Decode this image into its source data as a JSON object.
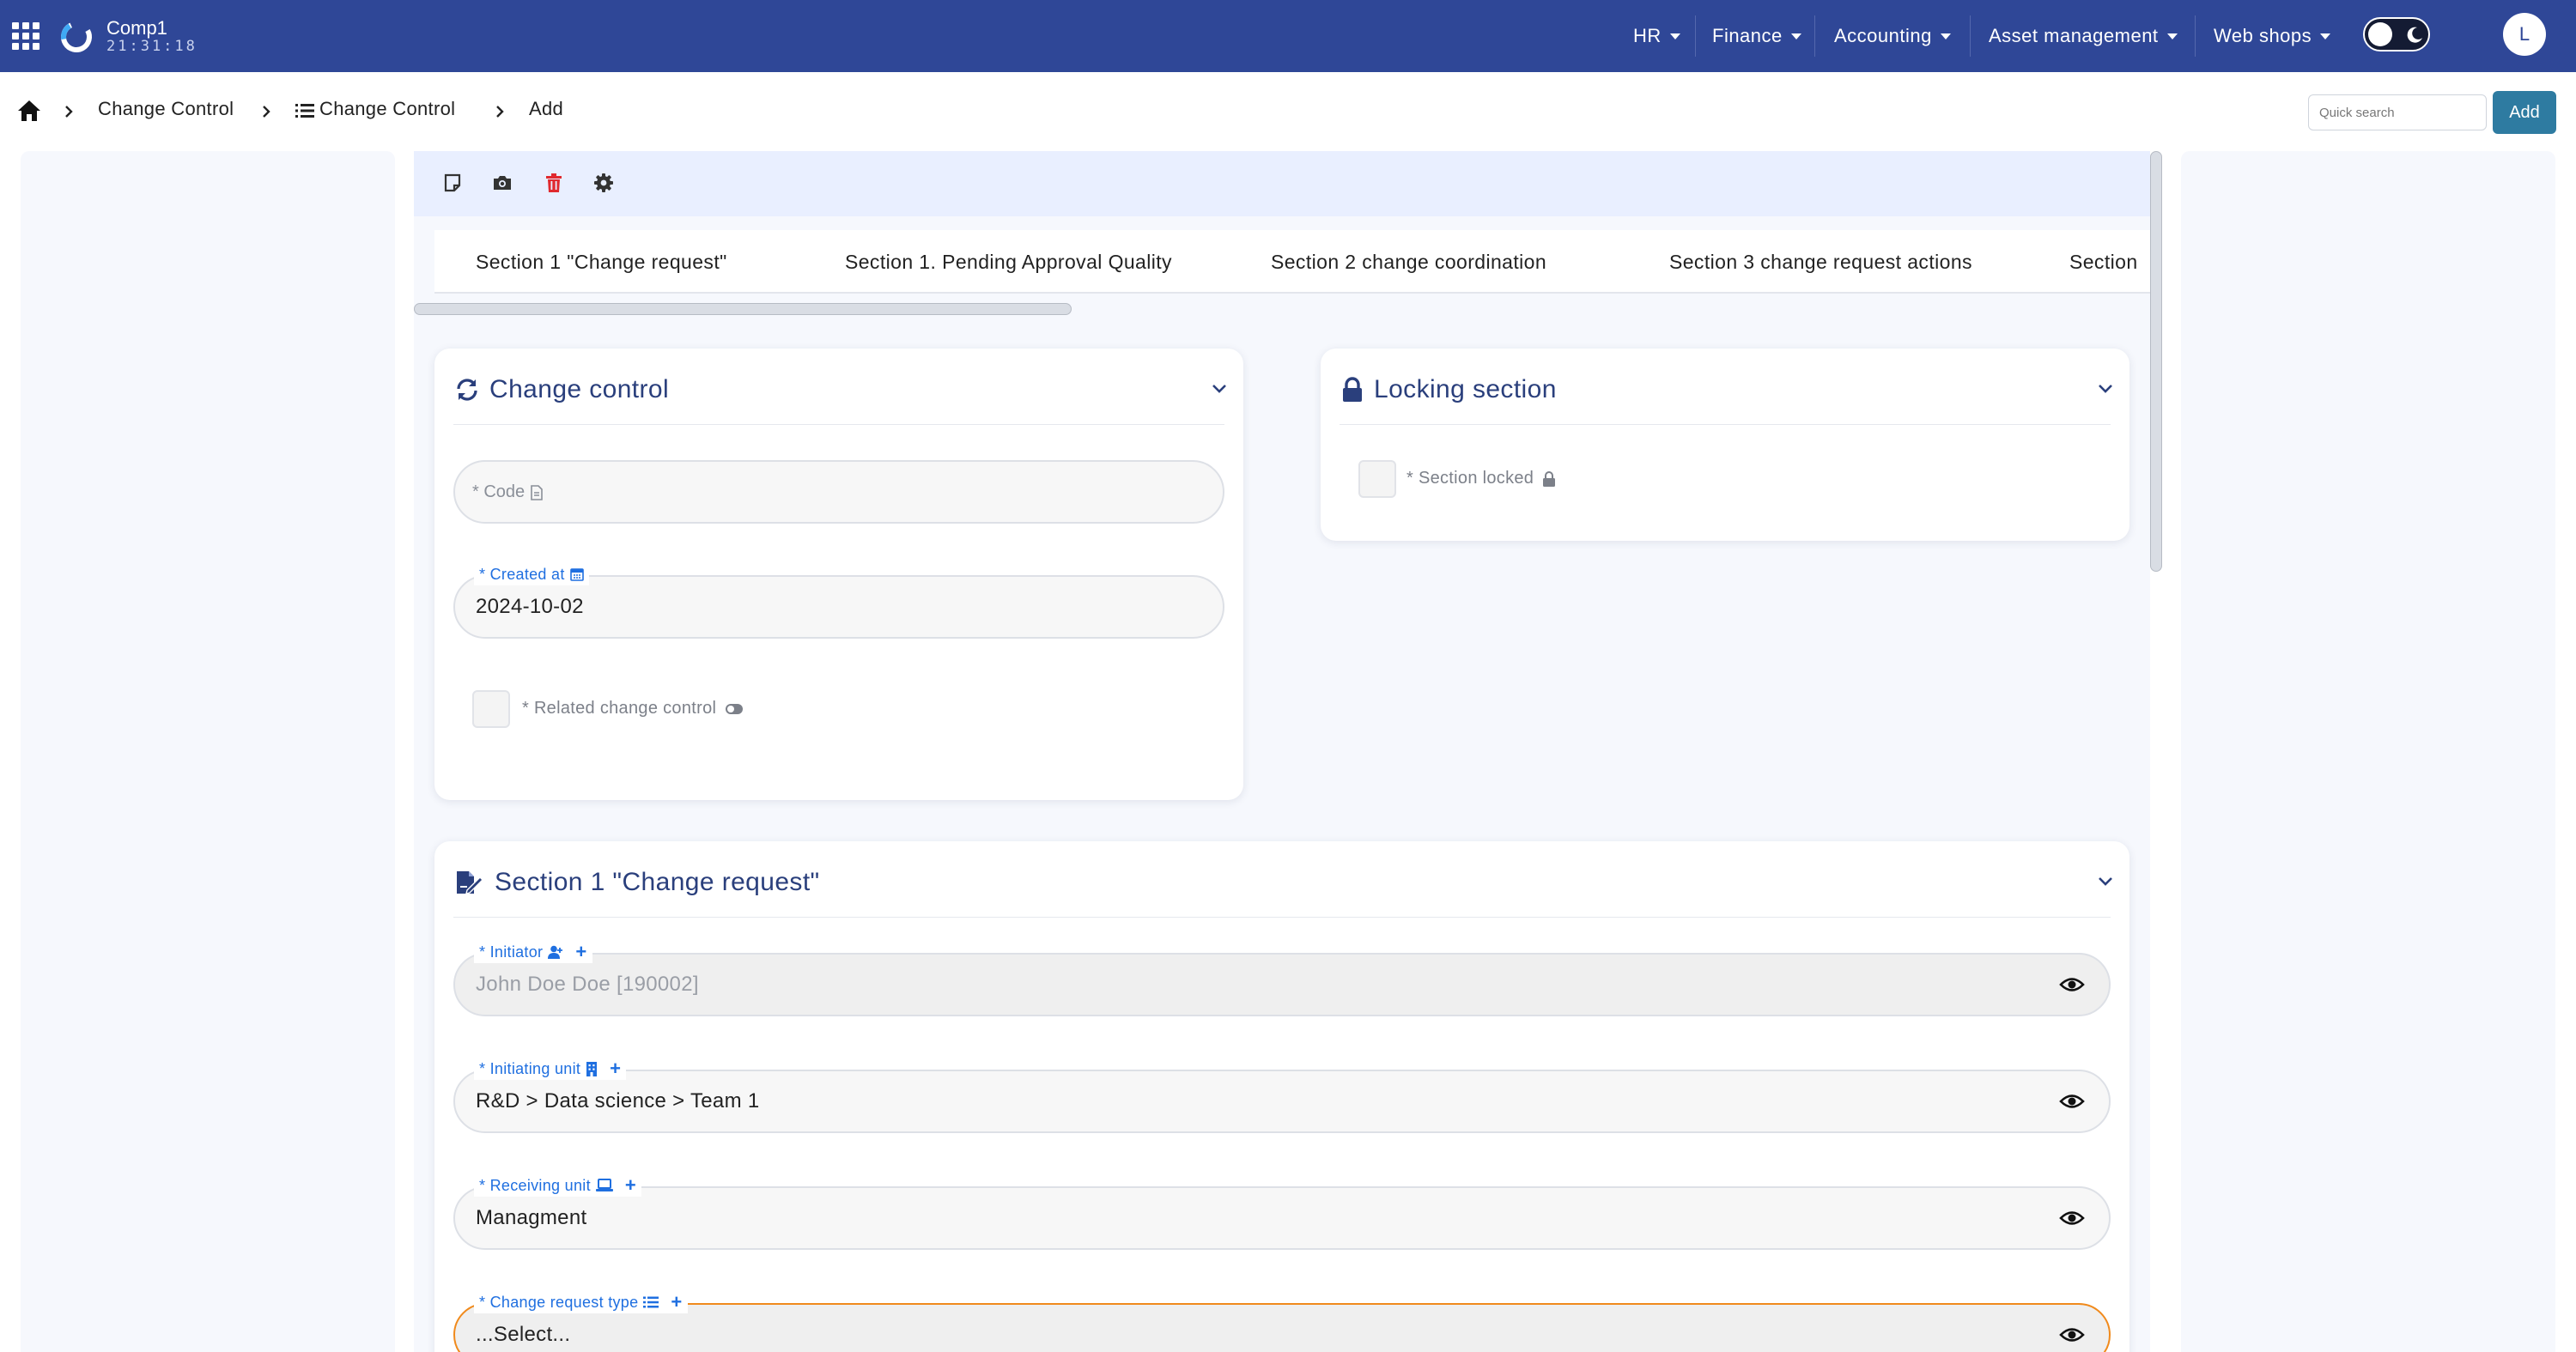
{
  "header": {
    "company": "Comp1",
    "clock": "21:31:18",
    "menus": [
      "HR",
      "Finance",
      "Accounting",
      "Asset management",
      "Web shops"
    ],
    "avatar_initial": "L"
  },
  "breadcrumb": {
    "items": [
      "Change Control",
      "Change Control",
      "Add"
    ]
  },
  "search": {
    "placeholder": "Quick search"
  },
  "actions": {
    "add_label": "Add"
  },
  "tabs": [
    "Section 1 \"Change request\"",
    "Section 1. Pending Approval Quality",
    "Section 2 change coordination",
    "Section 3 change request actions",
    "Section"
  ],
  "change_control": {
    "title": "Change control",
    "code_placeholder": "* Code",
    "created_at_label": "* Created at",
    "created_at_value": "2024-10-02",
    "related_label": "* Related change control"
  },
  "locking": {
    "title": "Locking section",
    "locked_label": "* Section locked"
  },
  "section1": {
    "title": "Section 1 \"Change request\"",
    "initiator_label": "* Initiator",
    "initiator_value": "John Doe Doe [190002]",
    "initiating_unit_label": "* Initiating unit",
    "initiating_unit_value": "R&D > Data science > Team 1",
    "receiving_unit_label": "* Receiving unit",
    "receiving_unit_value": "Managment",
    "change_type_label": "* Change request type",
    "change_type_value": "...Select...",
    "plus": "+"
  },
  "colors": {
    "topbar": "#2f4797",
    "accent_blue": "#1f6fe0",
    "title_blue": "#2a3f7c",
    "add_button": "#2e7ba1",
    "delete_red": "#e0292f",
    "required_orange": "#f08a1c"
  },
  "icons": {
    "apps": "apps-grid-icon",
    "logo": "logo-ring-icon",
    "home": "home-icon",
    "list": "list-icon",
    "note": "note-icon",
    "camera": "camera-icon",
    "trash": "trash-icon",
    "gear": "gear-icon",
    "sync": "sync-icon",
    "lock": "lock-icon",
    "edit": "edit-document-icon",
    "eye": "eye-icon"
  }
}
